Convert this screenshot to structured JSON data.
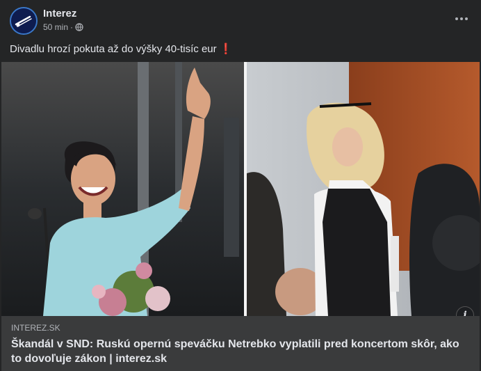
{
  "header": {
    "page_name": "Interez",
    "time": "50 min",
    "separator": "·",
    "privacy_icon": "globe-icon",
    "more_icon": "more-dots-icon"
  },
  "post": {
    "text": "Divadlu hrozí pokuta až do výšky 40-tisíc eur",
    "emoji": "❗"
  },
  "link_preview": {
    "domain": "INTEREZ.SK",
    "title": "Škandál v SND: Ruskú opernú speváčku Netrebko vyplatili pred koncertom skôr, ako to dovoľuje zákon | interez.sk",
    "info_icon": "info-icon",
    "info_label": "i"
  }
}
